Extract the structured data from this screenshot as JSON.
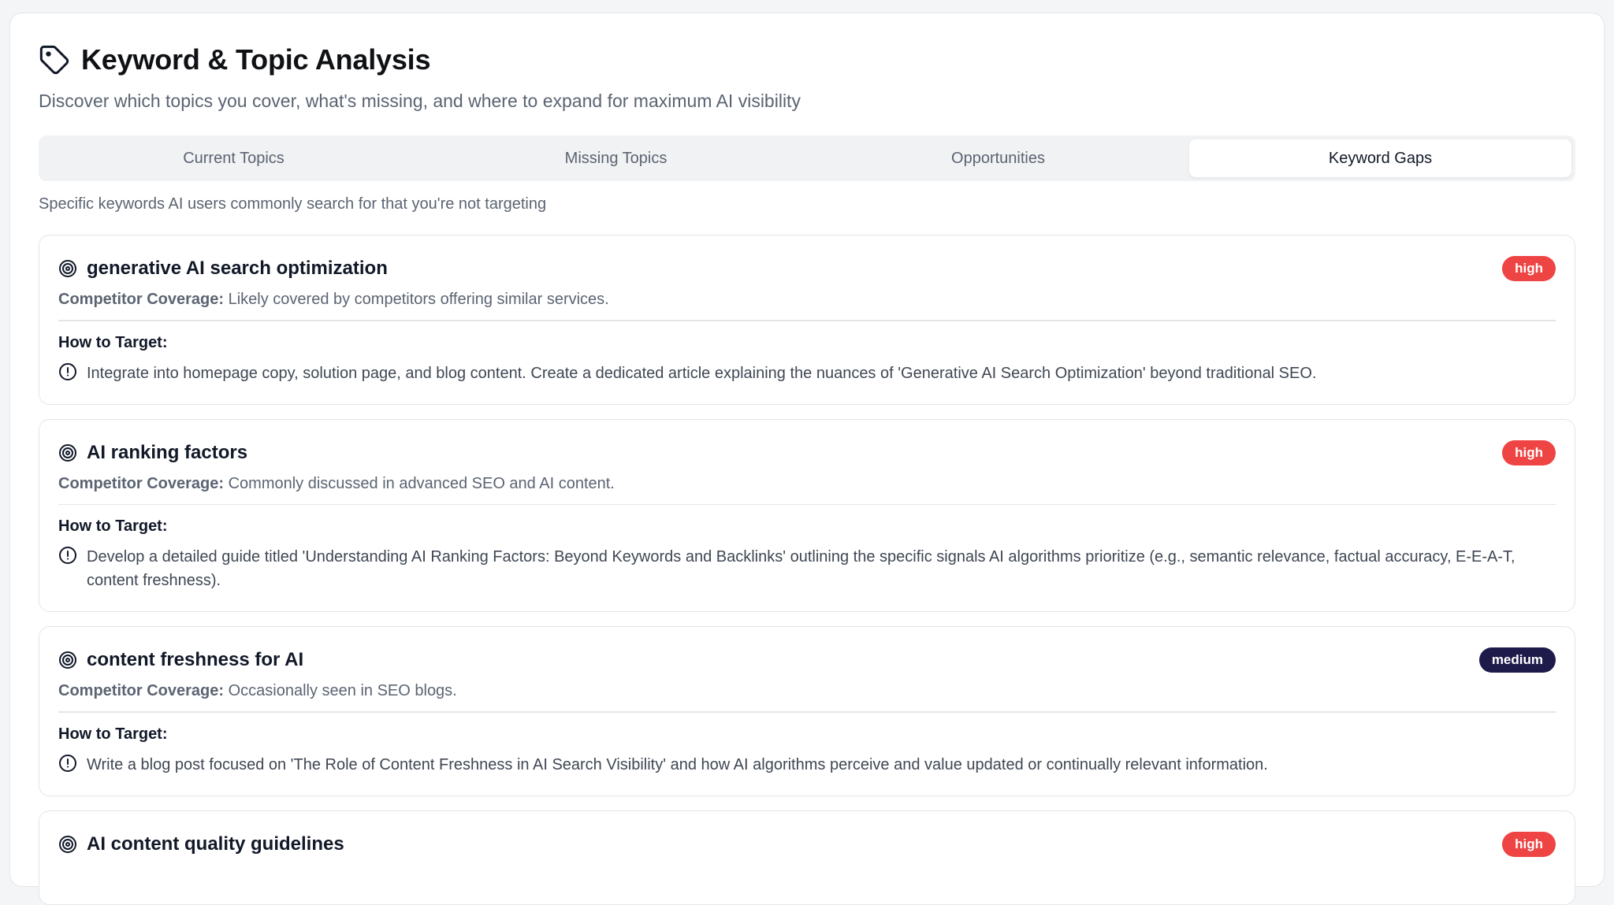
{
  "header": {
    "title": "Keyword & Topic Analysis",
    "subtitle": "Discover which topics you cover, what's missing, and where to expand for maximum AI visibility",
    "icon": "tag-icon"
  },
  "tabs": [
    {
      "label": "Current Topics",
      "active": false
    },
    {
      "label": "Missing Topics",
      "active": false
    },
    {
      "label": "Opportunities",
      "active": false
    },
    {
      "label": "Keyword Gaps",
      "active": true
    }
  ],
  "tab_description": "Specific keywords AI users commonly search for that you're not targeting",
  "labels": {
    "coverage": "Competitor Coverage:",
    "target": "How to Target:"
  },
  "colors": {
    "high": "#ef4444",
    "medium": "#1e1b4b"
  },
  "keywords": [
    {
      "title": "generative AI search optimization",
      "priority": "high",
      "coverage": "Likely covered by competitors offering similar services.",
      "target": "Integrate into homepage copy, solution page, and blog content. Create a dedicated article explaining the nuances of 'Generative AI Search Optimization' beyond traditional SEO."
    },
    {
      "title": "AI ranking factors",
      "priority": "high",
      "coverage": "Commonly discussed in advanced SEO and AI content.",
      "target": "Develop a detailed guide titled 'Understanding AI Ranking Factors: Beyond Keywords and Backlinks' outlining the specific signals AI algorithms prioritize (e.g., semantic relevance, factual accuracy, E-E-A-T, content freshness)."
    },
    {
      "title": "content freshness for AI",
      "priority": "medium",
      "coverage": "Occasionally seen in SEO blogs.",
      "target": "Write a blog post focused on 'The Role of Content Freshness in AI Search Visibility' and how AI algorithms perceive and value updated or continually relevant information."
    },
    {
      "title": "AI content quality guidelines",
      "priority": "high",
      "coverage": "",
      "target": ""
    }
  ]
}
